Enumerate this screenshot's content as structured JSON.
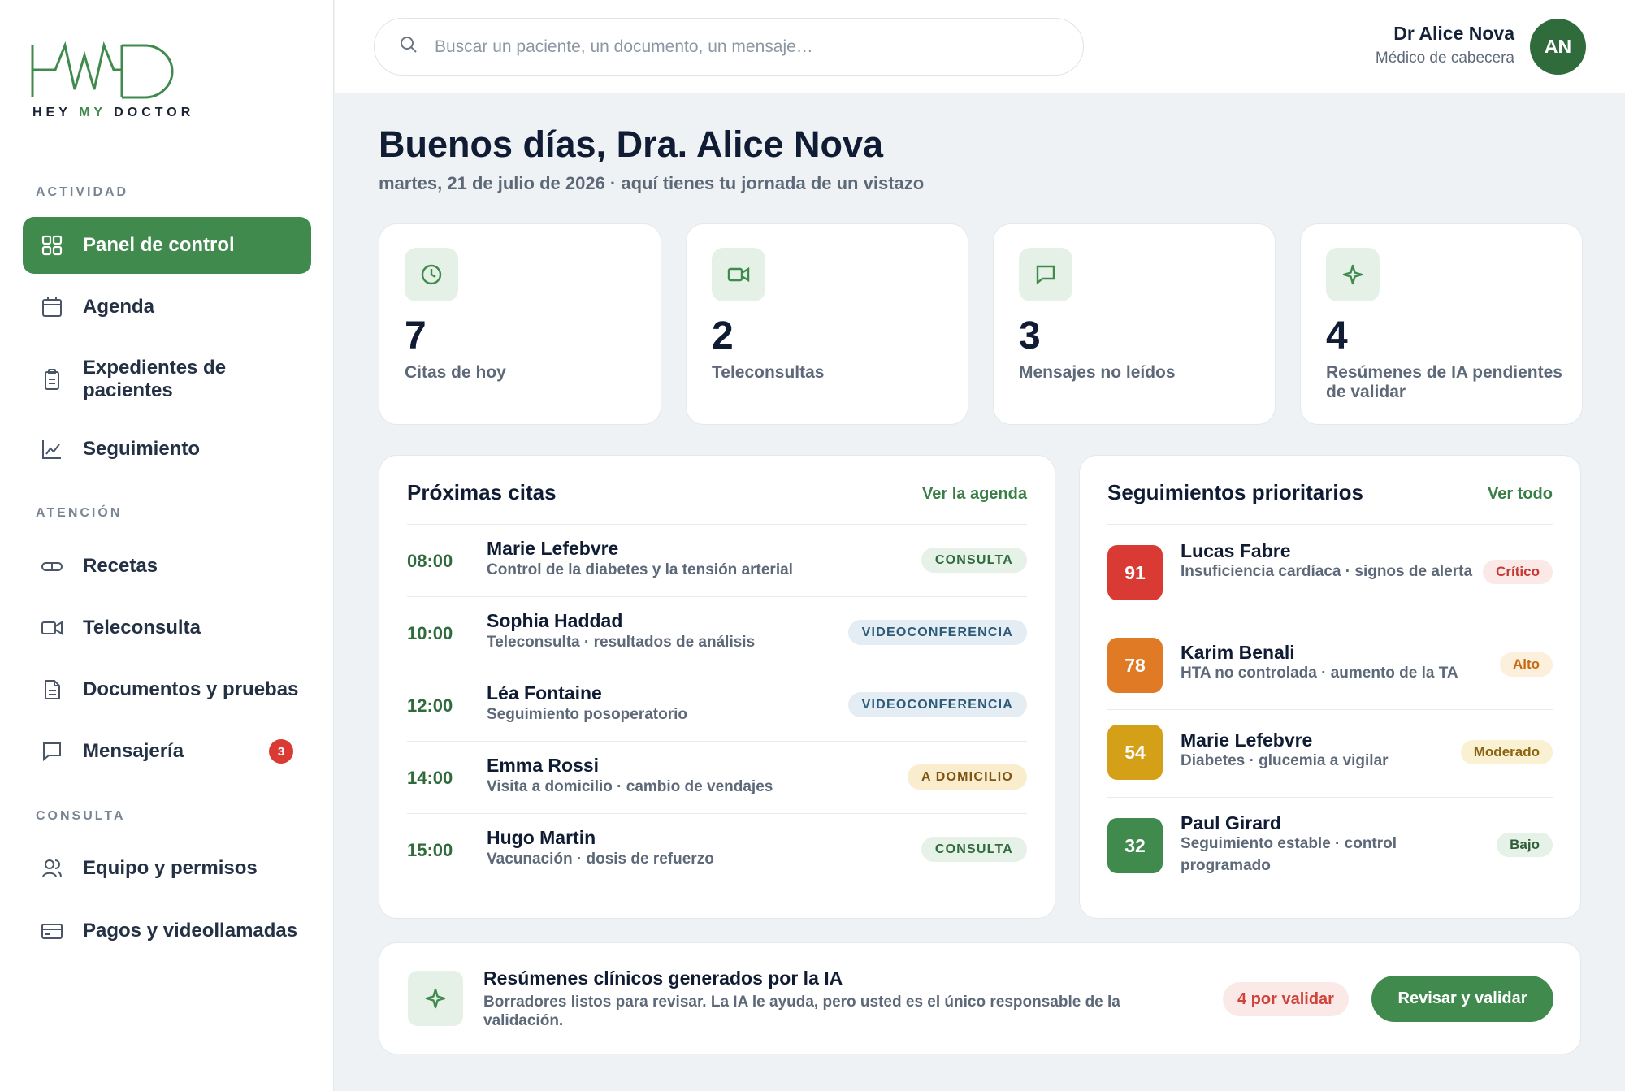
{
  "brand": {
    "logo_text_a": "HEY ",
    "logo_text_b": "MY",
    "logo_text_c": " DOCTOR",
    "accent": "#3f8a4c"
  },
  "sidebar": {
    "sections": [
      "ACTIVIDAD",
      "ATENCIÓN",
      "CONSULTA"
    ],
    "items": [
      {
        "label": "Panel de control",
        "icon": "grid-icon",
        "active": true
      },
      {
        "label": "Agenda",
        "icon": "calendar-icon"
      },
      {
        "label": "Expedientes de pacientes",
        "icon": "clipboard-icon"
      },
      {
        "label": "Seguimiento",
        "icon": "chart-line-icon"
      },
      {
        "label": "Recetas",
        "icon": "pill-icon"
      },
      {
        "label": "Teleconsulta",
        "icon": "video-icon"
      },
      {
        "label": "Documentos y pruebas",
        "icon": "document-icon"
      },
      {
        "label": "Mensajería",
        "icon": "message-icon",
        "badge": "3"
      },
      {
        "label": "Equipo y permisos",
        "icon": "users-icon"
      },
      {
        "label": "Pagos y videollamadas",
        "icon": "credit-card-icon"
      }
    ]
  },
  "header": {
    "search_placeholder": "Buscar un paciente, un documento, un mensaje…",
    "user_name": "Dr Alice Nova",
    "user_role": "Médico de cabecera",
    "avatar_initials": "AN"
  },
  "main": {
    "greeting": "Buenos días, Dra. Alice Nova",
    "subgreeting": "martes, 21 de julio de 2026 · aquí tienes tu jornada de un vistazo",
    "stats": [
      {
        "value": "7",
        "label": "Citas de hoy",
        "icon": "clock-icon"
      },
      {
        "value": "2",
        "label": "Teleconsultas",
        "icon": "video-icon"
      },
      {
        "value": "3",
        "label": "Mensajes no leídos",
        "icon": "message-icon"
      },
      {
        "value": "4",
        "label": "Resúmenes de IA pendientes de validar",
        "icon": "sparkle-icon"
      }
    ]
  },
  "appointments": {
    "title": "Próximas citas",
    "link": "Ver la agenda",
    "items": [
      {
        "time": "08:00",
        "name": "Marie Lefebvre",
        "desc": "Control de la diabetes y la tensión arterial",
        "tag": "CONSULTA"
      },
      {
        "time": "10:00",
        "name": "Sophia Haddad",
        "desc": "Teleconsulta · resultados de análisis",
        "tag": "VIDEOCONFERENCIA"
      },
      {
        "time": "12:00",
        "name": "Léa Fontaine",
        "desc": "Seguimiento posoperatorio",
        "tag": "VIDEOCONFERENCIA"
      },
      {
        "time": "14:00",
        "name": "Emma Rossi",
        "desc": "Visita a domicilio · cambio de vendajes",
        "tag": "A DOMICILIO"
      },
      {
        "time": "15:00",
        "name": "Hugo Martin",
        "desc": "Vacunación · dosis de refuerzo",
        "tag": "CONSULTA"
      }
    ]
  },
  "followups": {
    "title": "Seguimientos prioritarios",
    "link": "Ver todo",
    "items": [
      {
        "score": "91",
        "name": "Lucas Fabre",
        "desc": "Insuficiencia cardíaca · signos de alerta",
        "level": "Crítico",
        "color": "#d93b34"
      },
      {
        "score": "78",
        "name": "Karim Benali",
        "desc": "HTA no controlada · aumento de la TA",
        "level": "Alto",
        "color": "#e07a24"
      },
      {
        "score": "54",
        "name": "Marie Lefebvre",
        "desc": "Diabetes · glucemia a vigilar",
        "level": "Moderado",
        "color": "#d4a017"
      },
      {
        "score": "32",
        "name": "Paul Girard",
        "desc": "Seguimiento estable · control programado",
        "level": "Bajo",
        "color": "#3f8a4c"
      }
    ]
  },
  "ai_banner": {
    "title": "Resúmenes clínicos generados por la IA",
    "desc": "Borradores listos para revisar. La IA le ayuda, pero usted es el único responsable de la validación.",
    "pending": "4 por validar",
    "button": "Revisar y validar"
  }
}
